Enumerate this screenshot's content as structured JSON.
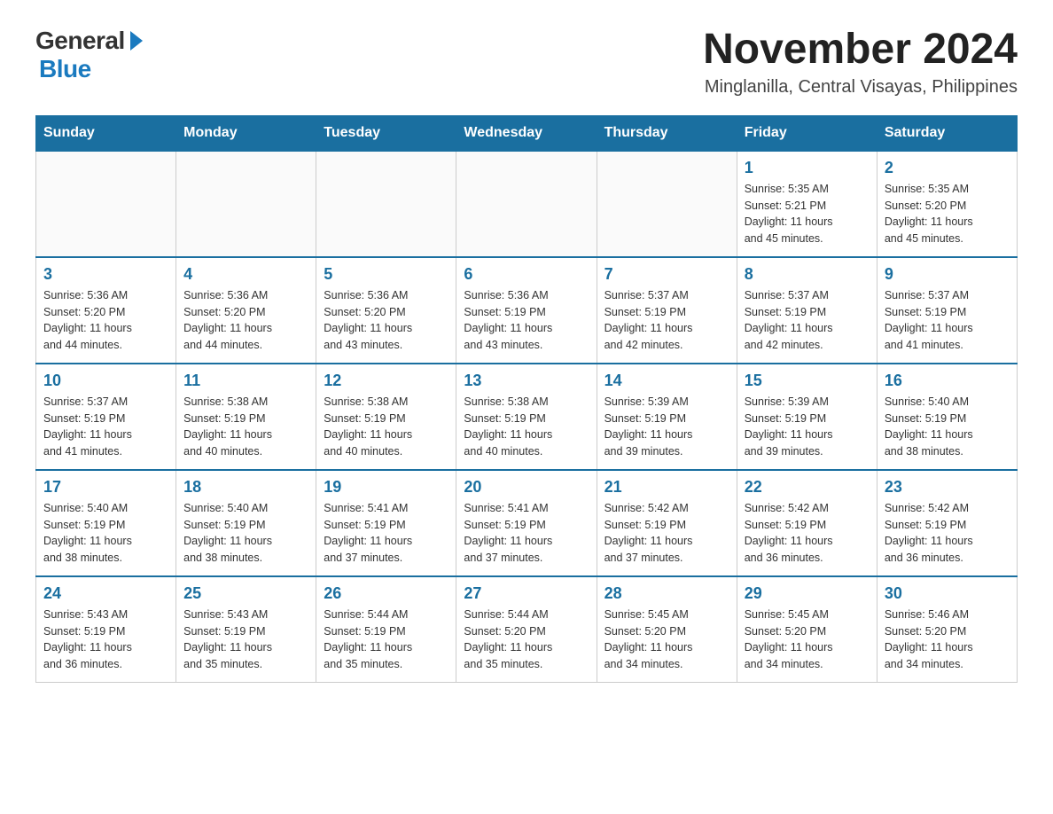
{
  "logo": {
    "general": "General",
    "blue": "Blue"
  },
  "header": {
    "month": "November 2024",
    "location": "Minglanilla, Central Visayas, Philippines"
  },
  "weekdays": [
    "Sunday",
    "Monday",
    "Tuesday",
    "Wednesday",
    "Thursday",
    "Friday",
    "Saturday"
  ],
  "weeks": [
    [
      {
        "day": "",
        "info": ""
      },
      {
        "day": "",
        "info": ""
      },
      {
        "day": "",
        "info": ""
      },
      {
        "day": "",
        "info": ""
      },
      {
        "day": "",
        "info": ""
      },
      {
        "day": "1",
        "info": "Sunrise: 5:35 AM\nSunset: 5:21 PM\nDaylight: 11 hours\nand 45 minutes."
      },
      {
        "day": "2",
        "info": "Sunrise: 5:35 AM\nSunset: 5:20 PM\nDaylight: 11 hours\nand 45 minutes."
      }
    ],
    [
      {
        "day": "3",
        "info": "Sunrise: 5:36 AM\nSunset: 5:20 PM\nDaylight: 11 hours\nand 44 minutes."
      },
      {
        "day": "4",
        "info": "Sunrise: 5:36 AM\nSunset: 5:20 PM\nDaylight: 11 hours\nand 44 minutes."
      },
      {
        "day": "5",
        "info": "Sunrise: 5:36 AM\nSunset: 5:20 PM\nDaylight: 11 hours\nand 43 minutes."
      },
      {
        "day": "6",
        "info": "Sunrise: 5:36 AM\nSunset: 5:19 PM\nDaylight: 11 hours\nand 43 minutes."
      },
      {
        "day": "7",
        "info": "Sunrise: 5:37 AM\nSunset: 5:19 PM\nDaylight: 11 hours\nand 42 minutes."
      },
      {
        "day": "8",
        "info": "Sunrise: 5:37 AM\nSunset: 5:19 PM\nDaylight: 11 hours\nand 42 minutes."
      },
      {
        "day": "9",
        "info": "Sunrise: 5:37 AM\nSunset: 5:19 PM\nDaylight: 11 hours\nand 41 minutes."
      }
    ],
    [
      {
        "day": "10",
        "info": "Sunrise: 5:37 AM\nSunset: 5:19 PM\nDaylight: 11 hours\nand 41 minutes."
      },
      {
        "day": "11",
        "info": "Sunrise: 5:38 AM\nSunset: 5:19 PM\nDaylight: 11 hours\nand 40 minutes."
      },
      {
        "day": "12",
        "info": "Sunrise: 5:38 AM\nSunset: 5:19 PM\nDaylight: 11 hours\nand 40 minutes."
      },
      {
        "day": "13",
        "info": "Sunrise: 5:38 AM\nSunset: 5:19 PM\nDaylight: 11 hours\nand 40 minutes."
      },
      {
        "day": "14",
        "info": "Sunrise: 5:39 AM\nSunset: 5:19 PM\nDaylight: 11 hours\nand 39 minutes."
      },
      {
        "day": "15",
        "info": "Sunrise: 5:39 AM\nSunset: 5:19 PM\nDaylight: 11 hours\nand 39 minutes."
      },
      {
        "day": "16",
        "info": "Sunrise: 5:40 AM\nSunset: 5:19 PM\nDaylight: 11 hours\nand 38 minutes."
      }
    ],
    [
      {
        "day": "17",
        "info": "Sunrise: 5:40 AM\nSunset: 5:19 PM\nDaylight: 11 hours\nand 38 minutes."
      },
      {
        "day": "18",
        "info": "Sunrise: 5:40 AM\nSunset: 5:19 PM\nDaylight: 11 hours\nand 38 minutes."
      },
      {
        "day": "19",
        "info": "Sunrise: 5:41 AM\nSunset: 5:19 PM\nDaylight: 11 hours\nand 37 minutes."
      },
      {
        "day": "20",
        "info": "Sunrise: 5:41 AM\nSunset: 5:19 PM\nDaylight: 11 hours\nand 37 minutes."
      },
      {
        "day": "21",
        "info": "Sunrise: 5:42 AM\nSunset: 5:19 PM\nDaylight: 11 hours\nand 37 minutes."
      },
      {
        "day": "22",
        "info": "Sunrise: 5:42 AM\nSunset: 5:19 PM\nDaylight: 11 hours\nand 36 minutes."
      },
      {
        "day": "23",
        "info": "Sunrise: 5:42 AM\nSunset: 5:19 PM\nDaylight: 11 hours\nand 36 minutes."
      }
    ],
    [
      {
        "day": "24",
        "info": "Sunrise: 5:43 AM\nSunset: 5:19 PM\nDaylight: 11 hours\nand 36 minutes."
      },
      {
        "day": "25",
        "info": "Sunrise: 5:43 AM\nSunset: 5:19 PM\nDaylight: 11 hours\nand 35 minutes."
      },
      {
        "day": "26",
        "info": "Sunrise: 5:44 AM\nSunset: 5:19 PM\nDaylight: 11 hours\nand 35 minutes."
      },
      {
        "day": "27",
        "info": "Sunrise: 5:44 AM\nSunset: 5:20 PM\nDaylight: 11 hours\nand 35 minutes."
      },
      {
        "day": "28",
        "info": "Sunrise: 5:45 AM\nSunset: 5:20 PM\nDaylight: 11 hours\nand 34 minutes."
      },
      {
        "day": "29",
        "info": "Sunrise: 5:45 AM\nSunset: 5:20 PM\nDaylight: 11 hours\nand 34 minutes."
      },
      {
        "day": "30",
        "info": "Sunrise: 5:46 AM\nSunset: 5:20 PM\nDaylight: 11 hours\nand 34 minutes."
      }
    ]
  ]
}
